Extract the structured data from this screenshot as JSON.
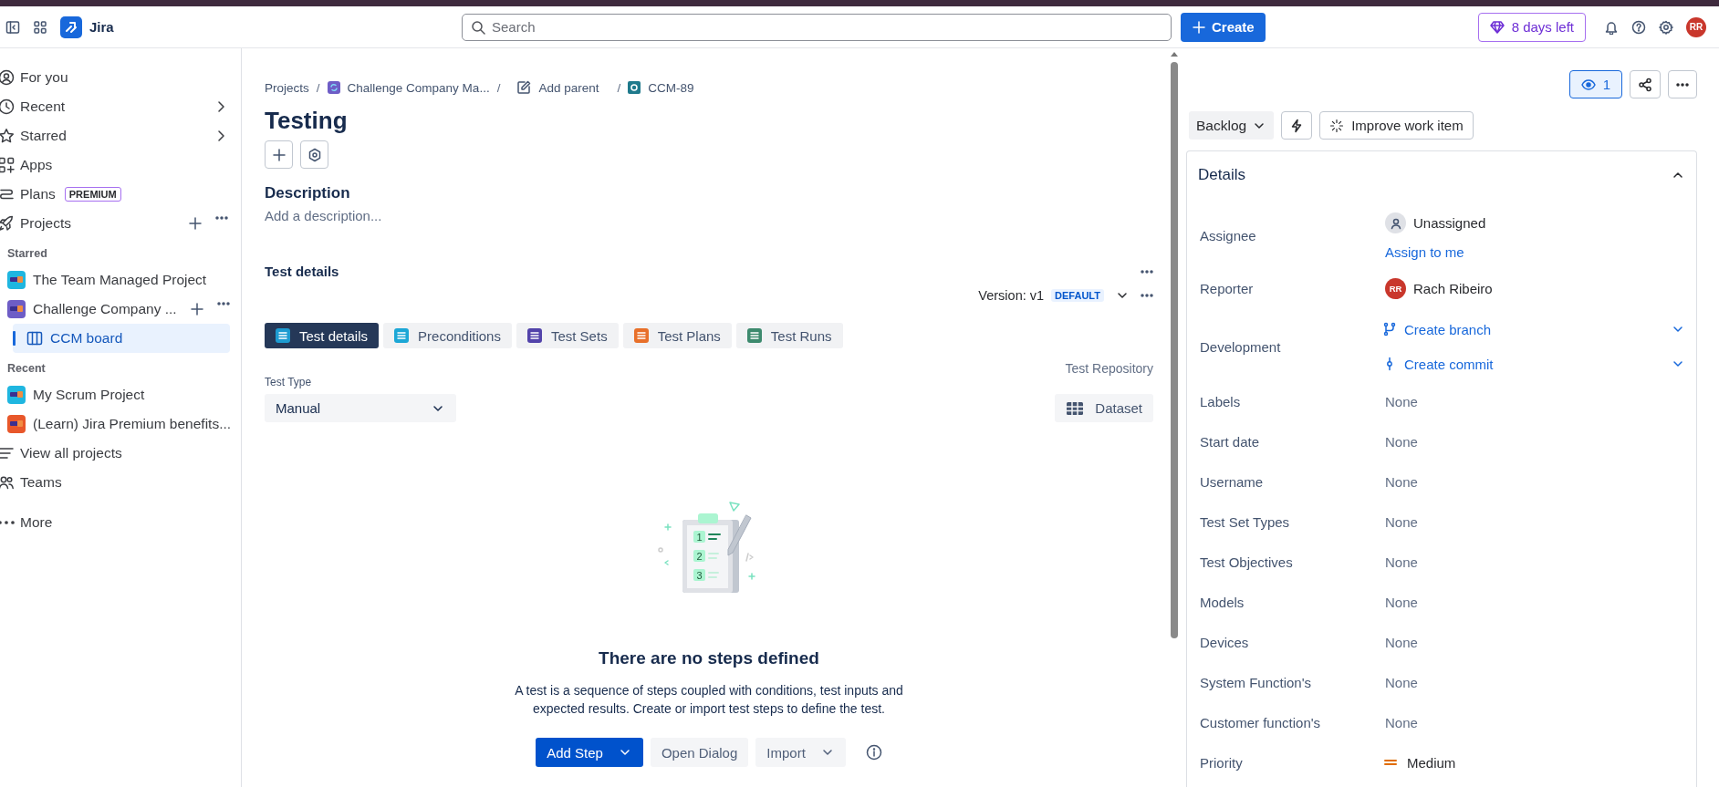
{
  "top_bar": {
    "product": "Jira",
    "search": {
      "placeholder": "Search"
    },
    "create_button": "Create",
    "trial_badge": "8 days left",
    "avatar": "RR"
  },
  "sidebar": {
    "items": [
      {
        "kind": "nav",
        "label": "For you",
        "selected": false
      },
      {
        "kind": "nav",
        "label": "Recent",
        "selected": false,
        "expandable": true
      },
      {
        "kind": "nav",
        "label": "Starred",
        "selected": false,
        "expandable": true
      },
      {
        "kind": "nav",
        "label": "Apps",
        "selected": false
      },
      {
        "kind": "nav",
        "label": "Plans",
        "selected": false,
        "badge": "PREMIUM"
      },
      {
        "kind": "nav",
        "label": "Projects",
        "selected": false,
        "actions": true
      },
      {
        "kind": "heading",
        "label": "Starred"
      },
      {
        "kind": "project",
        "label": "The Team Managed Project",
        "color": "#1fb6e0",
        "selected": false
      },
      {
        "kind": "project",
        "label": "Challenge Company ...",
        "color": "#6e5dc6",
        "selected": false,
        "actions": true,
        "children": [
          {
            "kind": "board",
            "label": "CCM board",
            "selected": true
          }
        ]
      },
      {
        "kind": "heading",
        "label": "Recent"
      },
      {
        "kind": "project",
        "label": "My Scrum Project",
        "color": "#1fb6e0",
        "selected": false
      },
      {
        "kind": "project",
        "label": "(Learn) Jira Premium benefits...",
        "color": "#e8572a",
        "selected": false
      },
      {
        "kind": "nav",
        "label": "View all projects",
        "selected": false
      },
      {
        "kind": "nav",
        "label": "Teams",
        "selected": false
      },
      {
        "kind": "nav",
        "label": "More",
        "selected": false
      }
    ]
  },
  "main": {
    "breadcrumbs": [
      {
        "kind": "link",
        "label": "Projects"
      },
      {
        "kind": "project",
        "separator": "/",
        "label": "Challenge Company Ma..."
      },
      {
        "kind": "add",
        "separator": "/",
        "label": "Add parent"
      },
      {
        "kind": "issue",
        "separator": "/",
        "label": "CCM-89"
      }
    ],
    "title": "Testing",
    "description": {
      "heading": "Description",
      "placeholder": "Add a description..."
    },
    "test_details": {
      "heading": "Test details",
      "version": "Version: v1",
      "version_badge": "DEFAULT",
      "tabs": [
        {
          "label": "Test details",
          "selected": true,
          "color": "#1d9bd1"
        },
        {
          "label": "Preconditions",
          "selected": false,
          "color": "#1ca7d6"
        },
        {
          "label": "Test Sets",
          "selected": false,
          "color": "#5243aa"
        },
        {
          "label": "Test Plans",
          "selected": false,
          "color": "#e8702a"
        },
        {
          "label": "Test Runs",
          "selected": false,
          "color": "#3d8a6e"
        }
      ],
      "repository_link": "Test Repository",
      "test_type": {
        "label": "Test Type",
        "value": "Manual"
      },
      "dataset_button": "Dataset",
      "empty_state": {
        "illustration_labels": [
          "1",
          "2",
          "3"
        ],
        "title": "There are no steps defined",
        "text": "A test is a sequence of steps coupled with conditions, test inputs and expected results. Create or import test steps to define the test."
      },
      "buttons": [
        {
          "kind": "primary",
          "label": "Add Step",
          "dropdown": true
        },
        {
          "kind": "secondary",
          "label": "Open Dialog"
        },
        {
          "kind": "secondary",
          "label": "Import",
          "dropdown": true
        }
      ]
    }
  },
  "details_panel": {
    "watchers": "1",
    "watching": true,
    "status": "Backlog",
    "improve_button": "Improve work item",
    "heading": "Details",
    "expanded": true,
    "fields": [
      {
        "kind": "user",
        "label": "Assignee",
        "value": "Unassigned",
        "action": "Assign to me"
      },
      {
        "kind": "person",
        "label": "Reporter",
        "value": "Rach Ribeiro",
        "initials": "RR"
      },
      {
        "kind": "development",
        "label": "Development",
        "links": [
          "Create branch",
          "Create commit"
        ]
      },
      {
        "kind": "text",
        "label": "Labels",
        "value": "None"
      },
      {
        "kind": "text",
        "label": "Start date",
        "value": "None"
      },
      {
        "kind": "text",
        "label": "Username",
        "value": "None"
      },
      {
        "kind": "text",
        "label": "Test Set Types",
        "value": "None"
      },
      {
        "kind": "text",
        "label": "Test Objectives",
        "value": "None"
      },
      {
        "kind": "text",
        "label": "Models",
        "value": "None"
      },
      {
        "kind": "text",
        "label": "Devices",
        "value": "None"
      },
      {
        "kind": "text",
        "label": "System Function's",
        "value": "None"
      },
      {
        "kind": "text",
        "label": "Customer function's",
        "value": "None"
      },
      {
        "kind": "priority",
        "label": "Priority",
        "value": "Medium"
      }
    ]
  }
}
